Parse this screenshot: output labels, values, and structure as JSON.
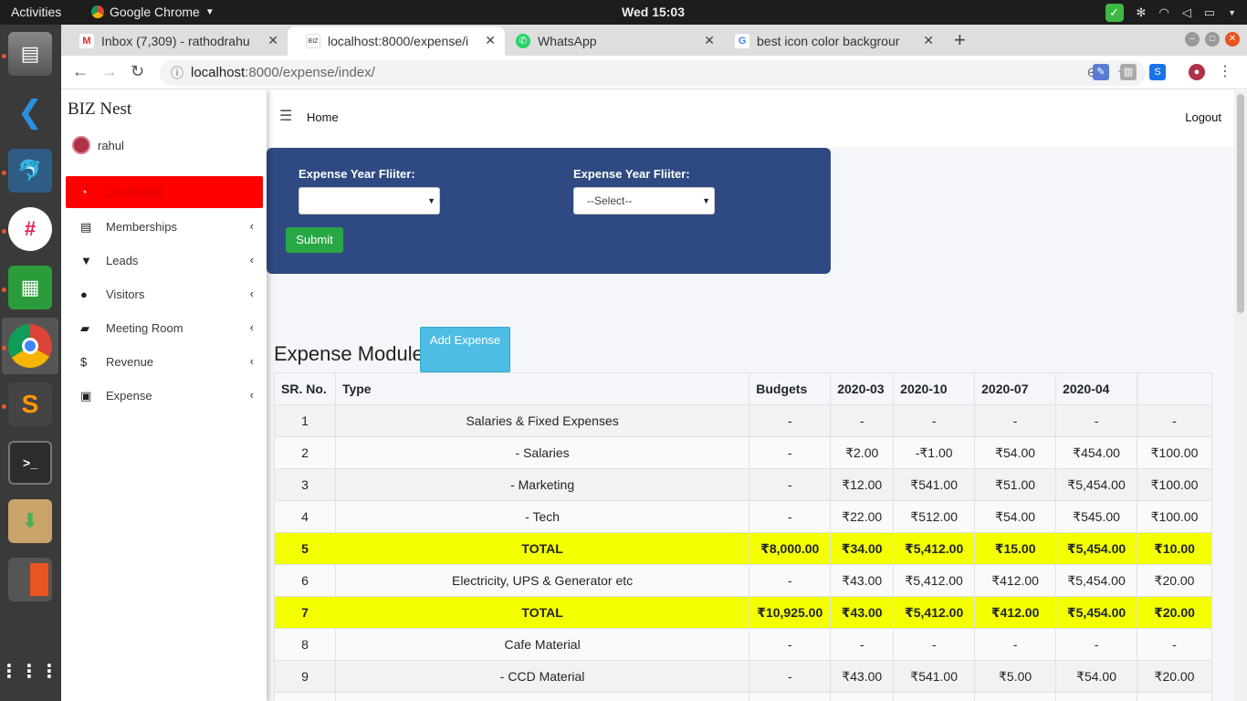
{
  "system": {
    "activities": "Activities",
    "app_name": "Google Chrome",
    "clock": "Wed 15:03"
  },
  "browser": {
    "tabs": [
      {
        "title": "Inbox (7,309) - rathodrahu",
        "icon": "gmail-icon"
      },
      {
        "title": "localhost:8000/expense/i",
        "icon": "biznest-icon"
      },
      {
        "title": "WhatsApp",
        "icon": "whatsapp-icon"
      },
      {
        "title": "best icon color backgrour",
        "icon": "google-icon"
      }
    ],
    "url_host": "localhost",
    "url_rest": ":8000/expense/index/"
  },
  "sidebar": {
    "brand": "BIZ Nest",
    "user": "rahul",
    "items": [
      {
        "label": "Dashboard",
        "icon": "dashboard-icon",
        "active": true
      },
      {
        "label": "Memberships",
        "icon": "id-card-icon"
      },
      {
        "label": "Leads",
        "icon": "filter-icon"
      },
      {
        "label": "Visitors",
        "icon": "clock-icon"
      },
      {
        "label": "Meeting Room",
        "icon": "book-icon"
      },
      {
        "label": "Revenue",
        "icon": "dollar-icon"
      },
      {
        "label": "Expense",
        "icon": "money-icon"
      }
    ]
  },
  "header": {
    "home": "Home",
    "logout": "Logout"
  },
  "filters": {
    "label1": "Expense Year Fliiter:",
    "select1_value": "",
    "label2": "Expense Year Fliiter:",
    "select2_value": "--Select--",
    "submit": "Submit"
  },
  "module": {
    "title": "Expense Module",
    "add_button": "Add Expense"
  },
  "table": {
    "headers": [
      "SR. No.",
      "Type",
      "Budgets",
      "2020-03",
      "2020-10",
      "2020-07",
      "2020-04",
      ""
    ],
    "rows": [
      {
        "cells": [
          "1",
          "Salaries & Fixed Expenses",
          "-",
          "-",
          "-",
          "-",
          "-",
          "-"
        ],
        "total": false
      },
      {
        "cells": [
          "2",
          "- Salaries",
          "-",
          "₹2.00",
          "-₹1.00",
          "₹54.00",
          "₹454.00",
          "₹100.00"
        ],
        "total": false
      },
      {
        "cells": [
          "3",
          "- Marketing",
          "-",
          "₹12.00",
          "₹541.00",
          "₹51.00",
          "₹5,454.00",
          "₹100.00"
        ],
        "total": false
      },
      {
        "cells": [
          "4",
          "- Tech",
          "-",
          "₹22.00",
          "₹512.00",
          "₹54.00",
          "₹545.00",
          "₹100.00"
        ],
        "total": false
      },
      {
        "cells": [
          "5",
          "TOTAL",
          "₹8,000.00",
          "₹34.00",
          "₹5,412.00",
          "₹15.00",
          "₹5,454.00",
          "₹10.00"
        ],
        "total": true
      },
      {
        "cells": [
          "6",
          "Electricity, UPS & Generator etc",
          "-",
          "₹43.00",
          "₹5,412.00",
          "₹412.00",
          "₹5,454.00",
          "₹20.00"
        ],
        "total": false
      },
      {
        "cells": [
          "7",
          "TOTAL",
          "₹10,925.00",
          "₹43.00",
          "₹5,412.00",
          "₹412.00",
          "₹5,454.00",
          "₹20.00"
        ],
        "total": true
      },
      {
        "cells": [
          "8",
          "Cafe Material",
          "-",
          "-",
          "-",
          "-",
          "-",
          "-"
        ],
        "total": false
      },
      {
        "cells": [
          "9",
          "- CCD Material",
          "-",
          "₹43.00",
          "₹541.00",
          "₹5.00",
          "₹54.00",
          "₹20.00"
        ],
        "total": false
      },
      {
        "cells": [
          "",
          "",
          "",
          "",
          "",
          "",
          "",
          ""
        ],
        "total": false
      }
    ]
  },
  "colors": {
    "filter_card": "#2f4a82",
    "active_menu": "#ff0000",
    "total_row": "#f4ff00",
    "submit": "#28a745",
    "add_button": "#4dbde3"
  }
}
